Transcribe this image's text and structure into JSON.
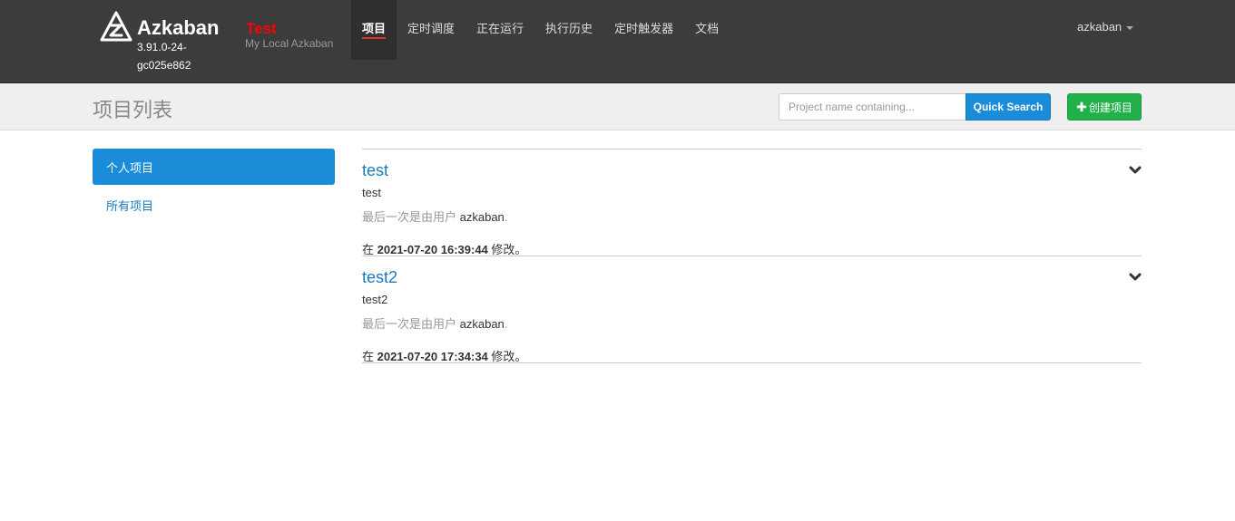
{
  "app": {
    "brand": "Azkaban",
    "version": "3.91.0-24-gc025e862",
    "env_name": "Test",
    "env_desc": "My Local Azkaban"
  },
  "nav": {
    "items": [
      {
        "label": "项目",
        "active": true
      },
      {
        "label": "定时调度",
        "active": false
      },
      {
        "label": "正在运行",
        "active": false
      },
      {
        "label": "执行历史",
        "active": false
      },
      {
        "label": "定时触发器",
        "active": false
      },
      {
        "label": "文档",
        "active": false
      }
    ],
    "user": "azkaban"
  },
  "header": {
    "title": "项目列表",
    "search_placeholder": "Project name containing...",
    "search_button": "Quick Search",
    "create_icon": "plus-icon",
    "create_button": "创建项目"
  },
  "sidebar": {
    "items": [
      {
        "label": "个人项目",
        "active": true
      },
      {
        "label": "所有项目",
        "active": false
      }
    ]
  },
  "projects": [
    {
      "name": "test",
      "description": "test",
      "uploaded_prefix": "最后一次是由用户",
      "uploader": "azkaban",
      "uploaded_suffix": ".",
      "modified_prefix": "在",
      "modified_time": "2021-07-20 16:39:44",
      "modified_suffix": "修改。"
    },
    {
      "name": "test2",
      "description": "test2",
      "uploaded_prefix": "最后一次是由用户",
      "uploader": "azkaban",
      "uploaded_suffix": ".",
      "modified_prefix": "在",
      "modified_time": "2021-07-20 17:34:34",
      "modified_suffix": "修改。"
    }
  ],
  "colors": {
    "navbar": "#3c3c3c",
    "accent_blue": "#1a8cd8",
    "create_green": "#22b04b",
    "env_red": "#ff0000"
  }
}
